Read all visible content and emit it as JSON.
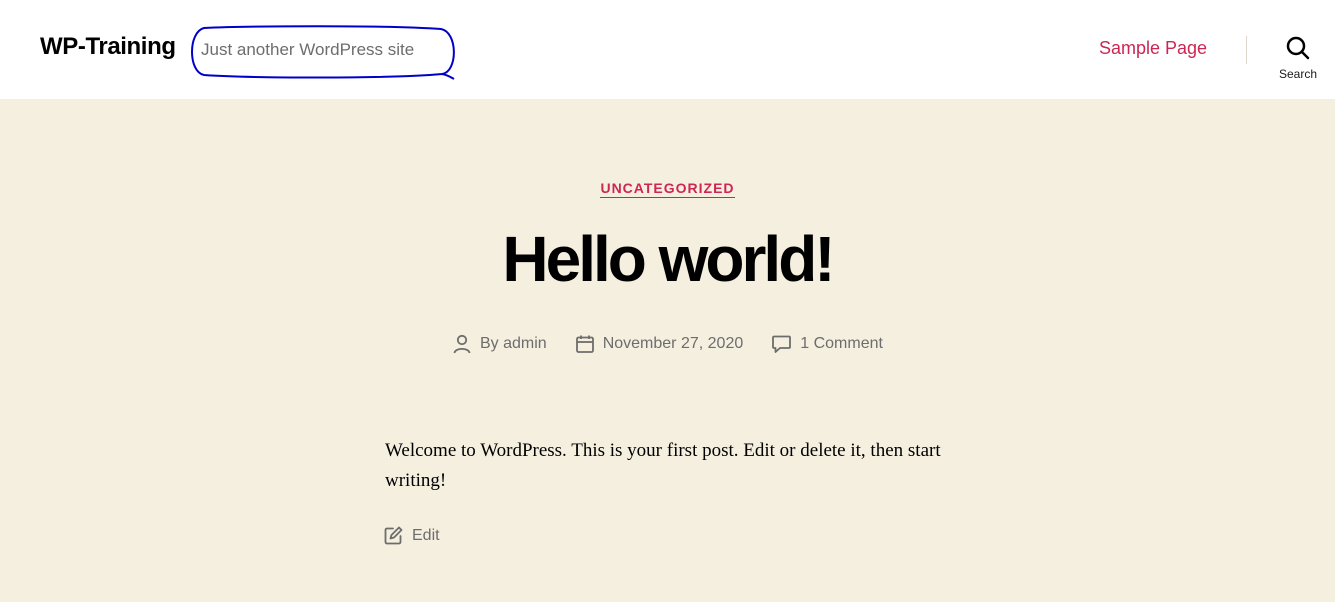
{
  "header": {
    "site_title": "WP-Training",
    "tagline": "Just another WordPress site",
    "nav": {
      "sample_page": "Sample Page"
    },
    "search": {
      "label": "Search"
    }
  },
  "post": {
    "category": "UNCATEGORIZED",
    "title": "Hello world!",
    "meta": {
      "author": "By admin",
      "date": "November 27, 2020",
      "comments": "1 Comment"
    },
    "excerpt": "Welcome to WordPress. This is your first post. Edit or delete it, then start writing!",
    "edit_label": "Edit"
  },
  "colors": {
    "accent": "#cd2653",
    "hero_background": "#f5efe0",
    "annotation": "#0000c8"
  }
}
